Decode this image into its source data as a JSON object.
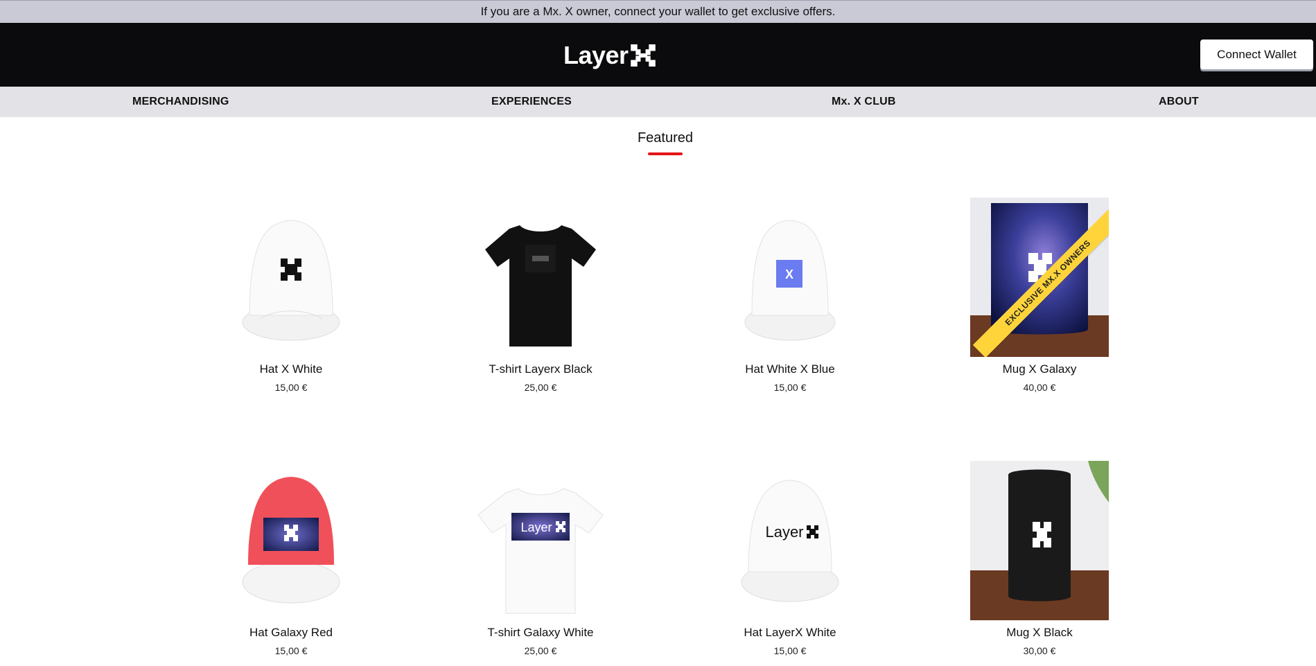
{
  "announcement": "If you are a Mx. X owner, connect your wallet to get exclusive offers.",
  "header": {
    "logo_text": "Layer",
    "connect_button": "Connect Wallet"
  },
  "nav": {
    "items": [
      {
        "label": "MERCHANDISING"
      },
      {
        "label": "EXPERIENCES"
      },
      {
        "label": "Mx. X CLUB"
      },
      {
        "label": "ABOUT"
      }
    ]
  },
  "featured": {
    "title": "Featured",
    "accent_color": "#e3151a"
  },
  "products": [
    {
      "name": "Hat X White",
      "price": "15,00 €",
      "image": "white-cap-black-x"
    },
    {
      "name": "T-shirt Layerx Black",
      "price": "25,00 €",
      "image": "black-tshirt"
    },
    {
      "name": "Hat White X Blue",
      "price": "15,00 €",
      "image": "white-cap-blue-x"
    },
    {
      "name": "Mug X Galaxy",
      "price": "40,00 €",
      "image": "galaxy-mug",
      "ribbon": "EXCLUSIVE MX.X OWNERS"
    },
    {
      "name": "Hat Galaxy Red",
      "price": "15,00 €",
      "image": "red-cap-galaxy"
    },
    {
      "name": "T-shirt Galaxy White",
      "price": "25,00 €",
      "image": "white-tshirt-galaxy"
    },
    {
      "name": "Hat LayerX White",
      "price": "15,00 €",
      "image": "white-cap-layerx"
    },
    {
      "name": "Mug X Black",
      "price": "30,00 €",
      "image": "black-mug"
    }
  ],
  "ribbon_color": "#ffd43b"
}
